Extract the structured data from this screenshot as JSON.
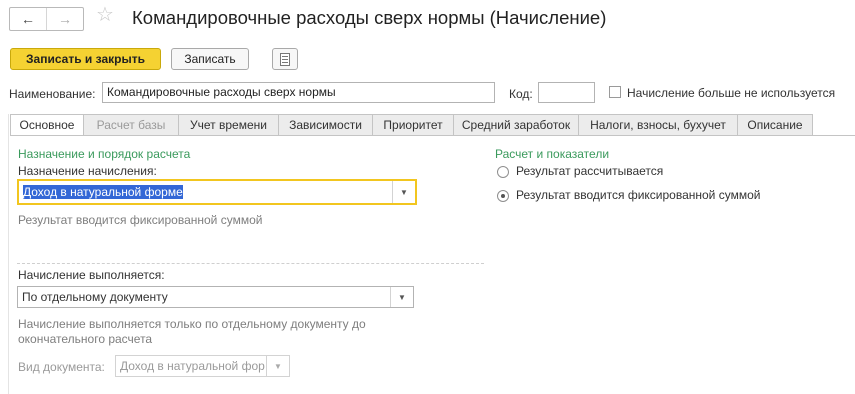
{
  "window": {
    "title": "Командировочные расходы сверх нормы (Начисление)",
    "nav_back": "←",
    "nav_forward": "→"
  },
  "toolbar": {
    "save_close": "Записать и закрыть",
    "save": "Записать"
  },
  "header": {
    "name_label": "Наименование:",
    "name_value": "Командировочные расходы сверх нормы",
    "code_label": "Код:",
    "code_value": "",
    "not_used_label": "Начисление больше не используется",
    "not_used_checked": false
  },
  "tabs": [
    {
      "label": "Основное",
      "state": "active"
    },
    {
      "label": "Расчет базы",
      "state": "disabled"
    },
    {
      "label": "Учет времени",
      "state": "normal"
    },
    {
      "label": "Зависимости",
      "state": "normal"
    },
    {
      "label": "Приоритет",
      "state": "normal"
    },
    {
      "label": "Средний заработок",
      "state": "normal"
    },
    {
      "label": "Налоги, взносы, бухучет",
      "state": "normal"
    },
    {
      "label": "Описание",
      "state": "normal"
    }
  ],
  "left": {
    "section_title": "Назначение и порядок расчета",
    "purpose_label": "Назначение начисления:",
    "purpose_value": "Доход в натуральной форме",
    "purpose_hint": "Результат вводится фиксированной суммой",
    "performed_label": "Начисление выполняется:",
    "performed_value": "По отдельному документу",
    "performed_hint": "Начисление выполняется только по отдельному документу до окончательного расчета",
    "doc_type_label": "Вид документа:",
    "doc_type_value": "Доход в натуральной фор"
  },
  "right": {
    "section_title": "Расчет и показатели",
    "options": [
      {
        "label": "Результат рассчитывается",
        "selected": false
      },
      {
        "label": "Результат вводится фиксированной суммой",
        "selected": true
      }
    ]
  },
  "colors": {
    "primary_button": "#f5d232",
    "section_green": "#3a9a5c",
    "focus_border": "#f2c61f",
    "selection": "#3367d6"
  },
  "icons": [
    "arrow-left-icon",
    "arrow-right-icon",
    "star-icon",
    "more-actions-icon",
    "dropdown-arrow-icon"
  ]
}
